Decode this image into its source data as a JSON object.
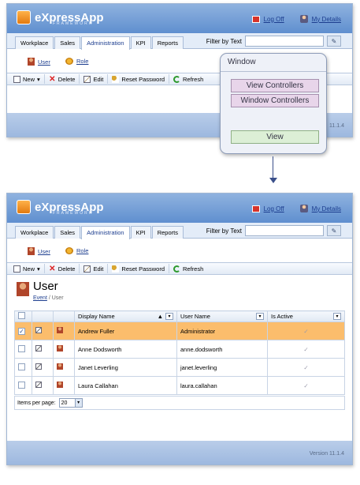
{
  "app": {
    "logo": "eXpressApp",
    "logo_sub": "FRAMEWORK",
    "logoff": "Log Off",
    "mydetails": "My Details"
  },
  "tabs": [
    "Workplace",
    "Sales",
    "Administration",
    "KPI",
    "Reports"
  ],
  "filter_label": "Filter by Text",
  "nav": {
    "user": "User",
    "role": "Role"
  },
  "toolbar": [
    "New",
    "Delete",
    "Edit",
    "Reset Password",
    "Refresh"
  ],
  "version_top": "11.1.4",
  "version_bottom": "Version 11.1.4",
  "popup": {
    "title": "Window",
    "items": [
      "View Controllers",
      "Window Controllers"
    ],
    "view": "View"
  },
  "view": {
    "title": "User",
    "crumb_link": "Event",
    "crumb_current": "User"
  },
  "grid": {
    "columns": [
      "Display Name",
      "User Name",
      "Is Active"
    ],
    "rows": [
      {
        "display": "Andrew Fuller",
        "user": "Administrator",
        "selected": true
      },
      {
        "display": "Anne Dodsworth",
        "user": "anne.dodsworth",
        "selected": false
      },
      {
        "display": "Janet Leverling",
        "user": "janet.leverling",
        "selected": false
      },
      {
        "display": "Laura Callahan",
        "user": "laura.callahan",
        "selected": false
      }
    ]
  },
  "pager": {
    "label": "Items per page:",
    "value": "20"
  }
}
